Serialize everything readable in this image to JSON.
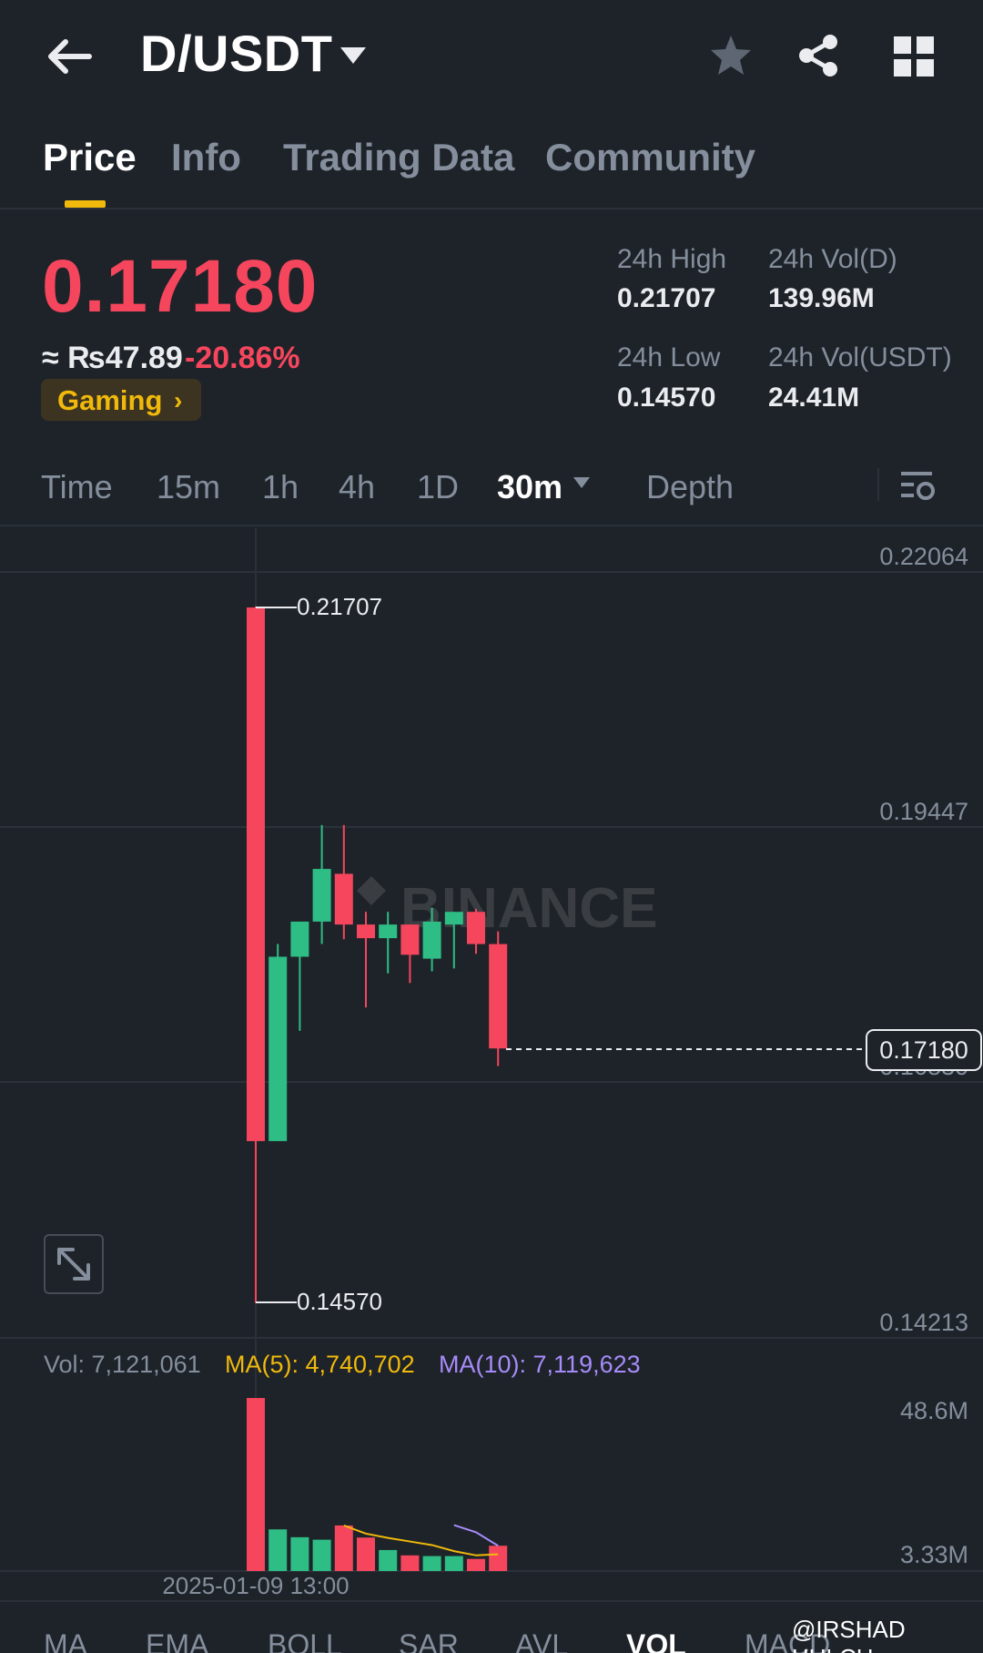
{
  "header": {
    "pair": "D/USDT"
  },
  "tabs": [
    "Price",
    "Info",
    "Trading Data",
    "Community"
  ],
  "price": {
    "last": "0.17180",
    "fiat": "≈ ₨47.89",
    "change": "-20.86%",
    "tag": "Gaming"
  },
  "stats": {
    "high_label": "24h High",
    "high_value": "0.21707",
    "vold_label": "24h Vol(D)",
    "vold_value": "139.96M",
    "low_label": "24h Low",
    "low_value": "0.14570",
    "volusdt_label": "24h Vol(USDT)",
    "volusdt_value": "24.41M"
  },
  "intervals": [
    "Time",
    "15m",
    "1h",
    "4h",
    "1D",
    "30m",
    "Depth"
  ],
  "active_interval": "30m",
  "chart": {
    "watermark": "BINANCE",
    "high_marker": "0.21707",
    "low_marker": "0.14570",
    "current_price_tag": "0.17180",
    "hidden_axis_label": "0.16830",
    "date_label": "2025-01-09 13:00"
  },
  "volume": {
    "vol_label": "Vol: 7,121,061",
    "ma5_label": "MA(5): 4,740,702",
    "ma10_label": "MA(10): 7,119,623"
  },
  "indicators": [
    "MA",
    "EMA",
    "BOLL",
    "SAR",
    "AVL",
    "VOL",
    "MACD"
  ],
  "active_indicator": "VOL",
  "credit": "@IRSHAD HULCH",
  "colors": {
    "up": "#2ebd85",
    "down": "#f6465d",
    "accent": "#f0b90b",
    "ma5": "#f0b90b",
    "ma10": "#a78bfa"
  },
  "chart_data": [
    {
      "type": "candlestick",
      "y_ticks": [
        "0.22064",
        "0.19447",
        "0.16830",
        "0.14213"
      ],
      "ylim": [
        0.14213,
        0.22064
      ],
      "candles": [
        {
          "o": 0.217,
          "h": 0.2171,
          "l": 0.1457,
          "c": 0.1623
        },
        {
          "o": 0.1623,
          "h": 0.1825,
          "l": 0.1623,
          "c": 0.1812
        },
        {
          "o": 0.1812,
          "h": 0.1826,
          "l": 0.1736,
          "c": 0.1848
        },
        {
          "o": 0.1848,
          "h": 0.1947,
          "l": 0.1825,
          "c": 0.1902
        },
        {
          "o": 0.1897,
          "h": 0.1947,
          "l": 0.183,
          "c": 0.1845
        },
        {
          "o": 0.1845,
          "h": 0.1858,
          "l": 0.176,
          "c": 0.1831
        },
        {
          "o": 0.1831,
          "h": 0.1858,
          "l": 0.1795,
          "c": 0.1845
        },
        {
          "o": 0.1845,
          "h": 0.1845,
          "l": 0.1785,
          "c": 0.1814
        },
        {
          "o": 0.181,
          "h": 0.1862,
          "l": 0.1797,
          "c": 0.1848
        },
        {
          "o": 0.1845,
          "h": 0.1858,
          "l": 0.18,
          "c": 0.1858
        },
        {
          "o": 0.1858,
          "h": 0.1861,
          "l": 0.1815,
          "c": 0.1825
        },
        {
          "o": 0.1825,
          "h": 0.1838,
          "l": 0.17,
          "c": 0.1718
        }
      ],
      "price_high": "0.21707",
      "price_low": "0.14570",
      "last_price": "0.17180"
    },
    {
      "type": "bar",
      "title": "",
      "y_ticks": [
        "48.6M",
        "3.33M"
      ],
      "ylim": [
        0,
        48.6
      ],
      "categories": [
        "2025-01-09 13:00"
      ],
      "series": [
        {
          "name": "Vol",
          "values": [
            48.6,
            11.7,
            9.5,
            8.8,
            12.8,
            9.4,
            5.9,
            4.4,
            4.2,
            4.2,
            3.4,
            7.1
          ],
          "colors": [
            "down",
            "up",
            "up",
            "up",
            "down",
            "down",
            "up",
            "down",
            "up",
            "up",
            "down",
            "down"
          ]
        },
        {
          "name": "MA(5)",
          "values": [
            null,
            null,
            null,
            null,
            12.8,
            10.5,
            9.3,
            8.3,
            7.3,
            5.6,
            4.4,
            4.7
          ]
        },
        {
          "name": "MA(10)",
          "values": [
            null,
            null,
            null,
            null,
            null,
            null,
            null,
            null,
            null,
            12.9,
            10.9,
            7.1
          ]
        }
      ]
    }
  ]
}
